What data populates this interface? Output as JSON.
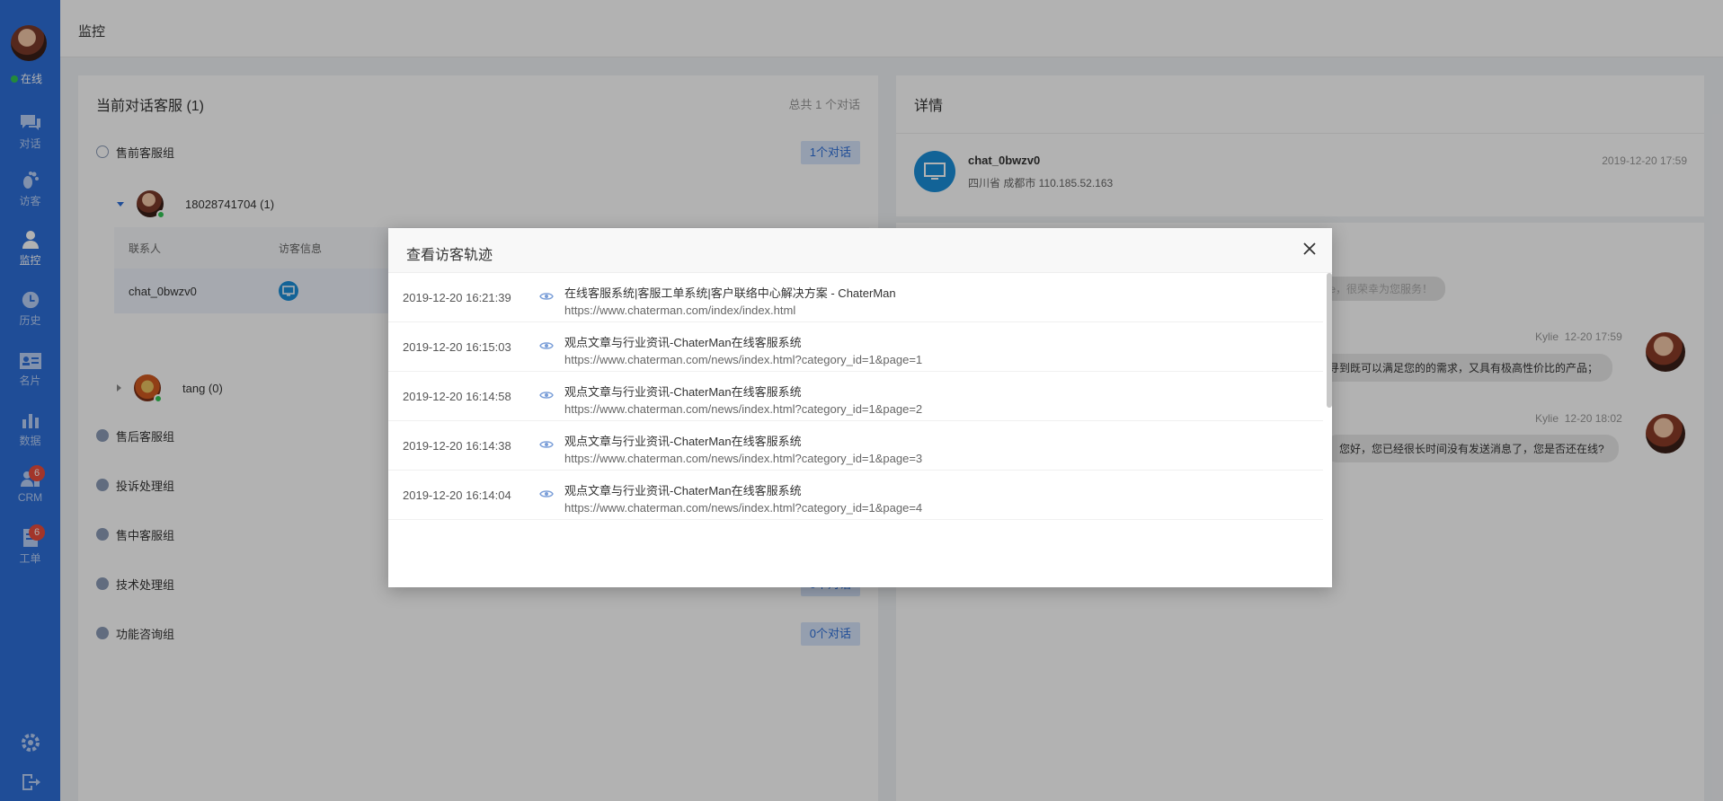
{
  "sidebar": {
    "status": "在线",
    "nav": [
      {
        "id": "chat",
        "icon": "chat-icon",
        "label": "对话"
      },
      {
        "id": "visitor",
        "icon": "footprint-icon",
        "label": "访客"
      },
      {
        "id": "monitor",
        "icon": "person-icon",
        "label": "监控",
        "active": true
      },
      {
        "id": "history",
        "icon": "clock-icon",
        "label": "历史"
      },
      {
        "id": "card",
        "icon": "id-card-icon",
        "label": "名片"
      },
      {
        "id": "data",
        "icon": "bar-chart-icon",
        "label": "数据"
      },
      {
        "id": "crm",
        "icon": "crm-icon",
        "label": "CRM",
        "badge": "6"
      },
      {
        "id": "ticket",
        "icon": "ticket-icon",
        "label": "工单",
        "badge": "6"
      }
    ]
  },
  "header": {
    "title": "监控"
  },
  "left": {
    "title": "当前对话客服 (1)",
    "meta": "总共 1 个对话",
    "groups": [
      {
        "label": "售前客服组",
        "count": "1个对话"
      },
      {
        "label": "售后客服组",
        "count": ""
      },
      {
        "label": "投诉处理组",
        "count": ""
      },
      {
        "label": "售中客服组",
        "count": ""
      },
      {
        "label": "技术处理组",
        "count": "0个对话"
      },
      {
        "label": "功能咨询组",
        "count": "0个对话"
      }
    ],
    "members": [
      {
        "name": "18028741704 (1)"
      },
      {
        "name": "tang (0)"
      }
    ],
    "table": {
      "headers": [
        "联系人",
        "访客信息"
      ],
      "rows": [
        [
          "chat_0bwzv0"
        ]
      ]
    }
  },
  "right": {
    "title": "详情",
    "visitor_name": "chat_0bwzv0",
    "location": "四川省 成都市   110.185.52.163",
    "time": "2019-12-20 17:59",
    "system_msg": "lie，很荣幸为您服务！",
    "messages": [
      {
        "sender": "Kylie",
        "time": "12-20 17:59",
        "text": "线寻到既可以满足您的的需求，又具有极高性价比的产品；"
      },
      {
        "sender": "Kylie",
        "time": "12-20 18:02",
        "text": "您好，您已经很长时间没有发送消息了，您是否还在线?"
      }
    ]
  },
  "modal": {
    "title": "查看访客轨迹",
    "rows": [
      {
        "time": "2019-12-20 16:21:39",
        "title": "在线客服系统|客服工单系统|客户联络中心解决方案 - ChaterMan",
        "url": "https://www.chaterman.com/index/index.html"
      },
      {
        "time": "2019-12-20 16:15:03",
        "title": "观点文章与行业资讯-ChaterMan在线客服系统",
        "url": "https://www.chaterman.com/news/index.html?category_id=1&page=1"
      },
      {
        "time": "2019-12-20 16:14:58",
        "title": "观点文章与行业资讯-ChaterMan在线客服系统",
        "url": "https://www.chaterman.com/news/index.html?category_id=1&page=2"
      },
      {
        "time": "2019-12-20 16:14:38",
        "title": "观点文章与行业资讯-ChaterMan在线客服系统",
        "url": "https://www.chaterman.com/news/index.html?category_id=1&page=3"
      },
      {
        "time": "2019-12-20 16:14:04",
        "title": "观点文章与行业资讯-ChaterMan在线客服系统",
        "url": "https://www.chaterman.com/news/index.html?category_id=1&page=4"
      }
    ]
  }
}
